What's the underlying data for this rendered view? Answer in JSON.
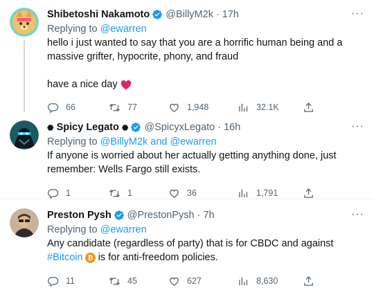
{
  "tweets": [
    {
      "name": "Shibetoshi Nakamoto",
      "handle": "@BillyM2k",
      "time": "17h",
      "replying_prefix": "Replying to ",
      "replying_to": "@ewarren",
      "text_line1": "hello i just wanted to say that you are a horrific human being and a",
      "text_line2": "massive grifter, hypocrite, phony, and fraud",
      "text_line3": "have a nice day",
      "emoji": "heart",
      "replies": "66",
      "retweets": "77",
      "likes": "1,948",
      "views": "32.1K"
    },
    {
      "name_prefix": "⬣",
      "name": "Spicy Legato",
      "name_suffix": "⬣",
      "handle": "@SpicyxLegato",
      "time": "16h",
      "replying_prefix": "Replying to ",
      "replying_to": "@BillyM2k and @ewarren",
      "text_line1": "If anyone is worried about her actually getting anything done, just",
      "text_line2": "remember: Wells Fargo still exists.",
      "replies": "1",
      "retweets": "1",
      "likes": "36",
      "views": "1,791"
    },
    {
      "name": "Preston Pysh",
      "handle": "@PrestonPysh",
      "time": "7h",
      "replying_prefix": "Replying to ",
      "replying_to": "@ewarren",
      "text_line1": "Any candidate (regardless of party) that is for CBDC and against",
      "hashtag": "#Bitcoin",
      "text_line2_rest": " is for anti-freedom policies.",
      "replies": "11",
      "retweets": "45",
      "likes": "627",
      "views": "8,630"
    }
  ],
  "colors": {
    "verified": "#1d9bf0",
    "link": "#1d9bf0",
    "muted": "#536471",
    "heart": "#e0245e",
    "bitcoin": "#f7931a"
  },
  "icons": [
    "verified-icon",
    "more-icon",
    "reply-icon",
    "retweet-icon",
    "like-icon",
    "views-icon",
    "share-icon",
    "heart-emoji-icon",
    "bitcoin-icon"
  ]
}
